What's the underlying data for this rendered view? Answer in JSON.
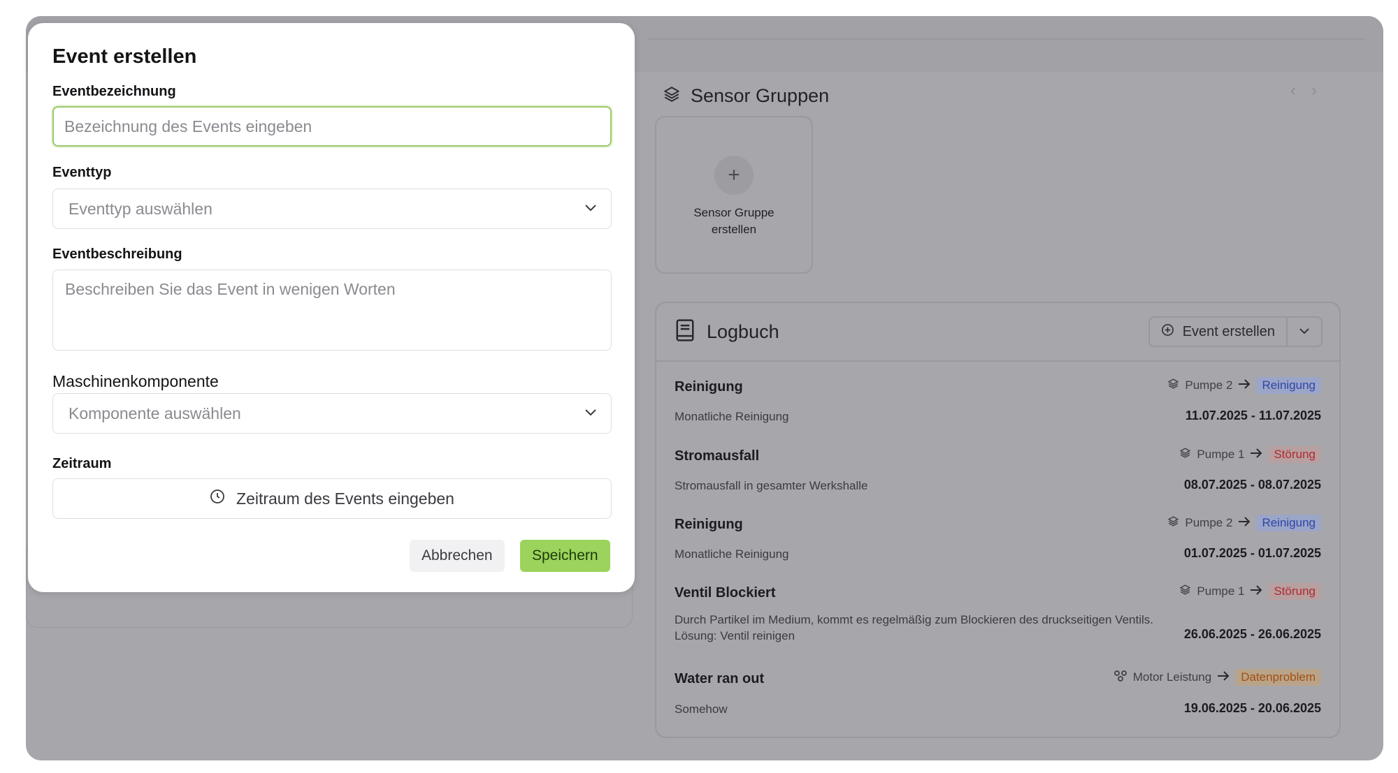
{
  "background": {
    "sensor_groups": {
      "title": "Sensor Gruppen",
      "create_card_label": "Sensor Gruppe erstellen"
    },
    "logbook": {
      "title": "Logbuch",
      "create_event_button": "Event erstellen",
      "entries": [
        {
          "title": "Reinigung",
          "component": "Pumpe 2",
          "type": "Reinigung",
          "description": "Monatliche Reinigung",
          "date_range": "11.07.2025 - 11.07.2025"
        },
        {
          "title": "Stromausfall",
          "component": "Pumpe 1",
          "type": "Störung",
          "description": "Stromausfall in gesamter Werkshalle",
          "date_range": "08.07.2025 - 08.07.2025"
        },
        {
          "title": "Reinigung",
          "component": "Pumpe 2",
          "type": "Reinigung",
          "description": "Monatliche Reinigung",
          "date_range": "01.07.2025 - 01.07.2025"
        },
        {
          "title": "Ventil Blockiert",
          "component": "Pumpe 1",
          "type": "Störung",
          "description": "Durch Partikel im Medium, kommt es regelmäßig zum Blockieren des druckseitigen Ventils. Lösung: Ventil reinigen",
          "date_range": "26.06.2025 - 26.06.2025"
        },
        {
          "title": "Water ran out",
          "component": "Motor Leistung",
          "type": "Datenproblem",
          "description": "Somehow",
          "date_range": "19.06.2025 - 20.06.2025"
        }
      ]
    }
  },
  "modal": {
    "title": "Event erstellen",
    "name_label": "Eventbezeichnung",
    "name_placeholder": "Bezeichnung des Events eingeben",
    "type_label": "Eventtyp",
    "type_placeholder": "Eventtyp auswählen",
    "description_label": "Eventbeschreibung",
    "description_placeholder": "Beschreiben Sie das Event in wenigen Worten",
    "component_label": "Maschinenkomponente",
    "component_placeholder": "Komponente auswählen",
    "period_label": "Zeitraum",
    "period_placeholder": "Zeitraum des Events eingeben",
    "cancel_label": "Abbrechen",
    "save_label": "Speichern"
  },
  "colors": {
    "accent_green": "#9bd35c",
    "focus_border": "#9bc968",
    "overlay_gray": "#a7a6ab",
    "badge_reinigung": "#2f46a5",
    "badge_stoerung": "#b02a2e",
    "badge_datenproblem": "#a24e12"
  },
  "icons": {
    "sensor_groups": "layers-icon",
    "logbook": "book-icon",
    "create_event": "plus-circle-icon",
    "component_pump": "layers-icon",
    "component_motor": "nodes-icon",
    "arrow": "arrow-right-icon",
    "select": "chevron-down-icon",
    "period": "clock-icon"
  }
}
